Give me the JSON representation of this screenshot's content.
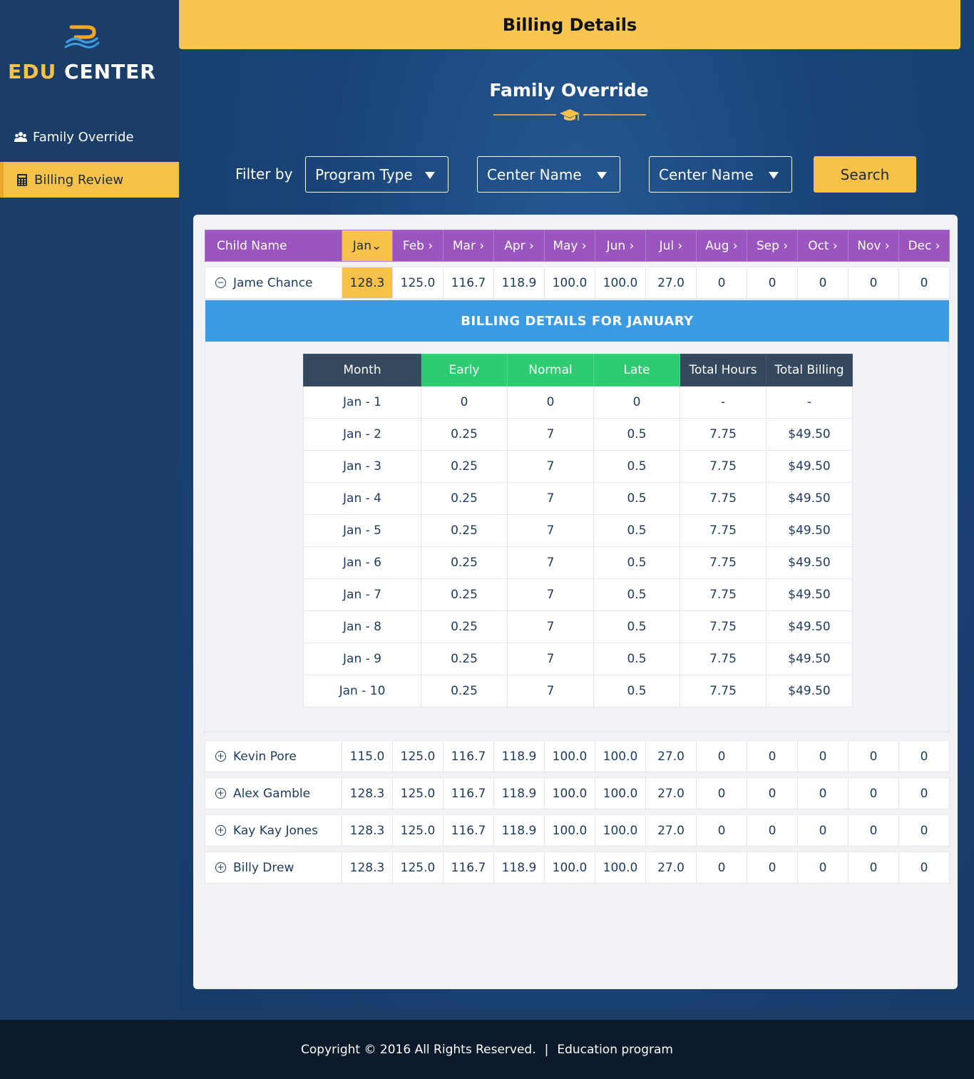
{
  "brand": {
    "edu": "EDU",
    "center": "CENTER"
  },
  "sidebar": {
    "items": [
      {
        "label": "Family Override",
        "icon": "users-icon"
      },
      {
        "label": "Billing Review",
        "icon": "calculator-icon",
        "active": true
      }
    ]
  },
  "topbar": {
    "title": "Billing Details"
  },
  "page": {
    "title": "Family Override"
  },
  "filters": {
    "label": "Filter by",
    "selects": [
      "Program Type",
      "Center Name",
      "Center Name"
    ],
    "search_label": "Search"
  },
  "table": {
    "headers": [
      "Child Name",
      "Jan",
      "Feb ›",
      "Mar ›",
      "Apr ›",
      "May ›",
      "Jun ›",
      "Jul ›",
      "Aug ›",
      "Sep ›",
      "Oct ›",
      "Nov ›",
      "Dec ›"
    ],
    "active_month_symbol": "⌄",
    "rows": [
      {
        "name": "Jame Chance",
        "expanded": true,
        "values": [
          "128.3",
          "125.0",
          "116.7",
          "118.9",
          "100.0",
          "100.0",
          "27.0",
          "0",
          "0",
          "0",
          "0",
          "0"
        ]
      },
      {
        "name": "Kevin Pore",
        "expanded": false,
        "values": [
          "115.0",
          "125.0",
          "116.7",
          "118.9",
          "100.0",
          "100.0",
          "27.0",
          "0",
          "0",
          "0",
          "0",
          "0"
        ]
      },
      {
        "name": "Alex Gamble",
        "expanded": false,
        "values": [
          "128.3",
          "125.0",
          "116.7",
          "118.9",
          "100.0",
          "100.0",
          "27.0",
          "0",
          "0",
          "0",
          "0",
          "0"
        ]
      },
      {
        "name": "Kay Kay Jones",
        "expanded": false,
        "values": [
          "128.3",
          "125.0",
          "116.7",
          "118.9",
          "100.0",
          "100.0",
          "27.0",
          "0",
          "0",
          "0",
          "0",
          "0"
        ]
      },
      {
        "name": "Billy Drew",
        "expanded": false,
        "values": [
          "128.3",
          "125.0",
          "116.7",
          "118.9",
          "100.0",
          "100.0",
          "27.0",
          "0",
          "0",
          "0",
          "0",
          "0"
        ]
      }
    ]
  },
  "details": {
    "banner": "BILLING DETAILS FOR JANUARY",
    "headers": [
      "Month",
      "Early",
      "Normal",
      "Late",
      "Total Hours",
      "Total Billing"
    ],
    "rows": [
      [
        "Jan - 1",
        "0",
        "0",
        "0",
        "-",
        "-"
      ],
      [
        "Jan - 2",
        "0.25",
        "7",
        "0.5",
        "7.75",
        "$49.50"
      ],
      [
        "Jan - 3",
        "0.25",
        "7",
        "0.5",
        "7.75",
        "$49.50"
      ],
      [
        "Jan - 4",
        "0.25",
        "7",
        "0.5",
        "7.75",
        "$49.50"
      ],
      [
        "Jan - 5",
        "0.25",
        "7",
        "0.5",
        "7.75",
        "$49.50"
      ],
      [
        "Jan - 6",
        "0.25",
        "7",
        "0.5",
        "7.75",
        "$49.50"
      ],
      [
        "Jan - 7",
        "0.25",
        "7",
        "0.5",
        "7.75",
        "$49.50"
      ],
      [
        "Jan - 8",
        "0.25",
        "7",
        "0.5",
        "7.75",
        "$49.50"
      ],
      [
        "Jan - 9",
        "0.25",
        "7",
        "0.5",
        "7.75",
        "$49.50"
      ],
      [
        "Jan - 10",
        "0.25",
        "7",
        "0.5",
        "7.75",
        "$49.50"
      ]
    ]
  },
  "footer": {
    "copyright": "Copyright © 2016 All Rights Reserved.",
    "separator": "|",
    "program": "Education program"
  },
  "colors": {
    "accent": "#f8c24a",
    "header_purple": "#9b55bf",
    "banner_blue": "#3b9ae0",
    "green": "#2ecc71",
    "dark": "#34495e"
  }
}
